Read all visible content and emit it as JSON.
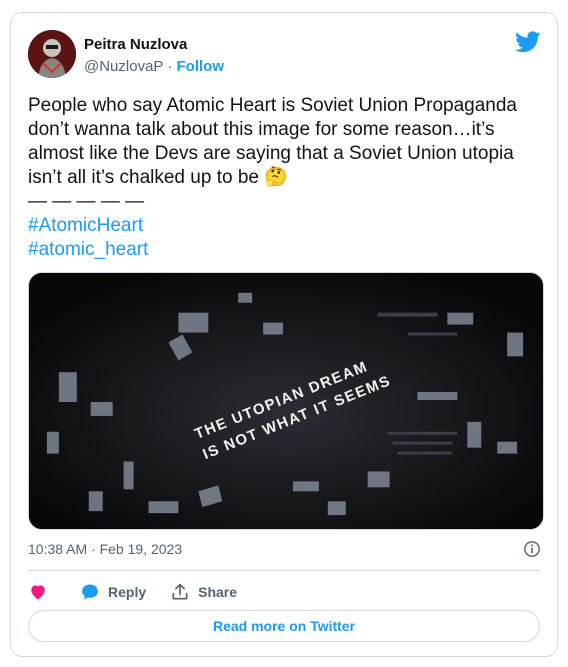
{
  "author": {
    "name": "Peitra Nuzlova",
    "handle": "@NuzlovaP",
    "separator": " · ",
    "follow_label": "Follow"
  },
  "tweet": {
    "text": "People who say Atomic Heart is Soviet Union Propaganda don’t wanna talk about this image for some reason…it’s almost like the Devs are saying that a Soviet Union utopia isn’t all it’s chalked up to be 🤔",
    "dashes": "— — — — —",
    "hashtags": [
      "#AtomicHeart",
      "#atomic_heart"
    ]
  },
  "media": {
    "line1": "THE UTOPIAN DREAM",
    "line2": "IS NOT WHAT IT SEEMS"
  },
  "timestamp": "10:38 AM · Feb 19, 2023",
  "actions": {
    "reply_label": "Reply",
    "share_label": "Share"
  },
  "read_more_label": "Read more on Twitter",
  "colors": {
    "accent": "#1d9bf0",
    "like": "#f91880",
    "muted": "#536471"
  }
}
